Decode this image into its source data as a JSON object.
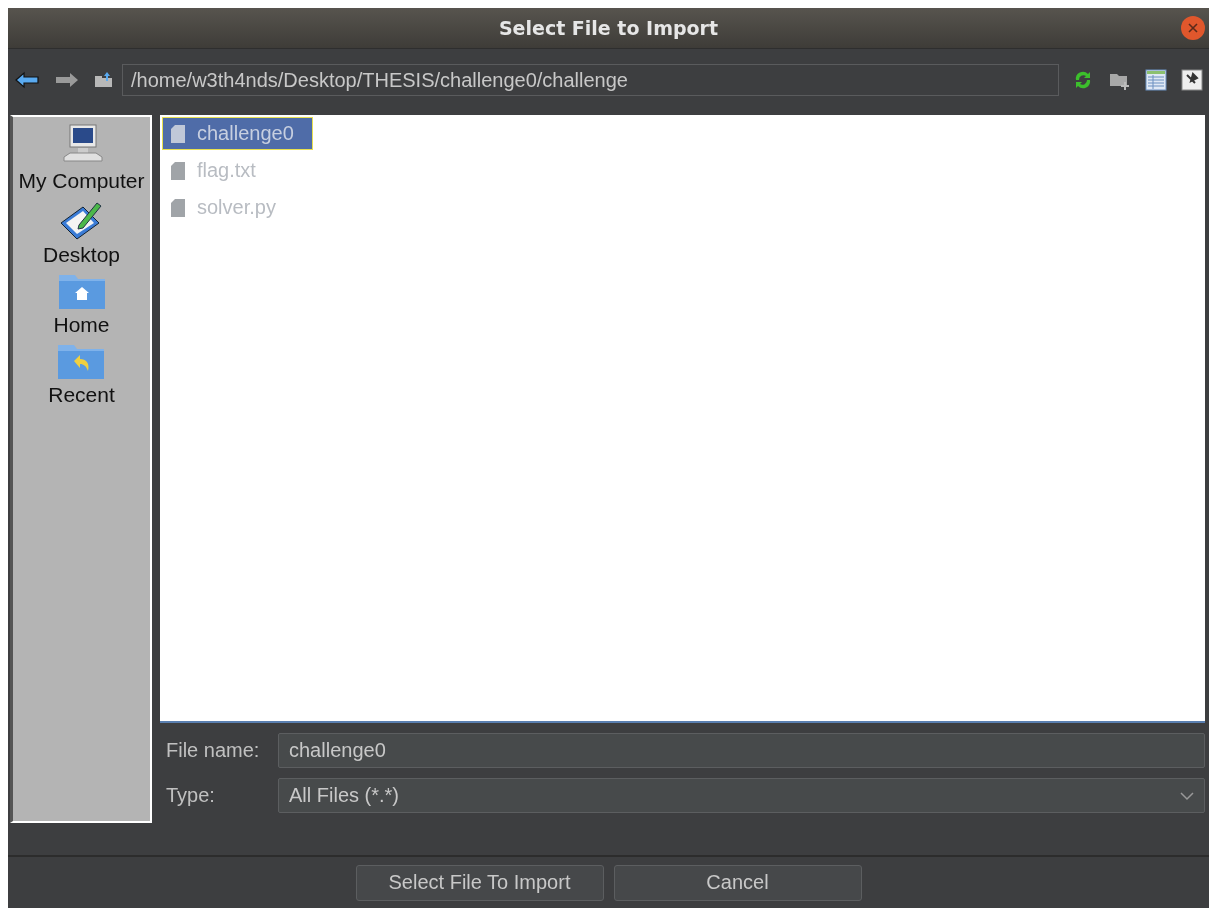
{
  "window": {
    "title": "Select File to Import"
  },
  "toolbar": {
    "path": "/home/w3th4nds/Desktop/THESIS/challenge0/challenge"
  },
  "sidebar": {
    "items": [
      {
        "kind": "computer",
        "label": "My Computer"
      },
      {
        "kind": "desktop",
        "label": "Desktop"
      },
      {
        "kind": "home",
        "label": "Home"
      },
      {
        "kind": "recent",
        "label": "Recent"
      }
    ]
  },
  "files": [
    {
      "name": "challenge0",
      "selected": true
    },
    {
      "name": "flag.txt",
      "selected": false
    },
    {
      "name": "solver.py",
      "selected": false
    }
  ],
  "file_name": {
    "label": "File name:",
    "value": "challenge0"
  },
  "type": {
    "label": "Type:",
    "value": "All Files (*.*)"
  },
  "buttons": [
    {
      "label": "Select File To Import"
    },
    {
      "label": "Cancel"
    }
  ]
}
